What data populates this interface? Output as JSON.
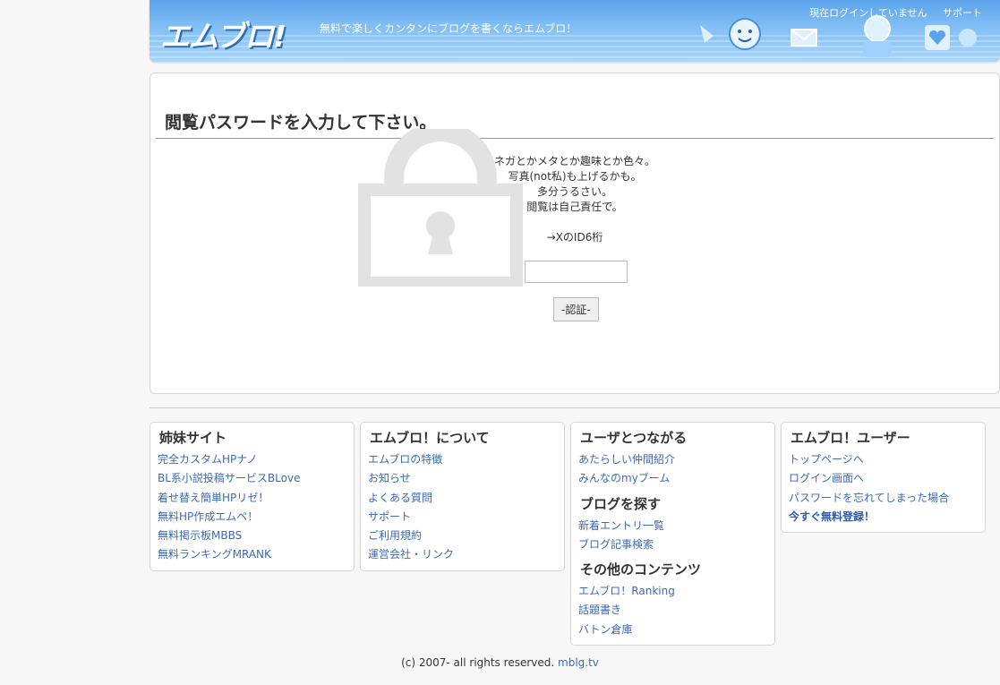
{
  "header": {
    "logo": "エムブロ!",
    "tagline": "無料で楽しくカンタンにブログを書くならエムブロ！",
    "login_status": "現在ログインしていません",
    "support": "サポート"
  },
  "main": {
    "title": "閲覧パスワードを入力して下さい。",
    "message_lines": [
      "ネガとかメタとか趣味とか色々。",
      "写真(not私)も上げるかも。",
      "多分うるさい。",
      "閲覧は自己責任で。",
      "",
      "→XのID6桁"
    ],
    "password_value": "",
    "auth_button": "-認証-"
  },
  "footer": {
    "columns": [
      {
        "title": "姉妹サイト",
        "links": [
          "完全カスタムHPナノ",
          "BL系小説投稿サービスBLove",
          "着せ替え簡単HPリゼ！",
          "無料HP作成エムペ！",
          "無料掲示板MBBS",
          "無料ランキングMRANK"
        ]
      },
      {
        "title": "エムブロ！について",
        "links": [
          "エムブロの特徴",
          "お知らせ",
          "よくある質問",
          "サポート",
          "ご利用規約",
          "運営会社・リンク"
        ]
      },
      {
        "title": "ユーザとつながる",
        "links": [
          "あたらしい仲間紹介",
          "みんなのmyブーム"
        ],
        "sub1_title": "ブログを探す",
        "sub1_links": [
          "新着エントリ一覧",
          "ブログ記事検索"
        ],
        "sub2_title": "その他のコンテンツ",
        "sub2_links": [
          "エムブロ！Ranking",
          "話題書き",
          "バトン倉庫"
        ]
      },
      {
        "title": "エムブロ！ユーザー",
        "links": [
          "トップページへ",
          "ログイン画面へ",
          "パスワードを忘れてしまった場合",
          "今すぐ無料登録！"
        ]
      }
    ],
    "copyright_text": "(c) 2007- all rights reserved.",
    "copyright_link": "mblg.tv"
  }
}
